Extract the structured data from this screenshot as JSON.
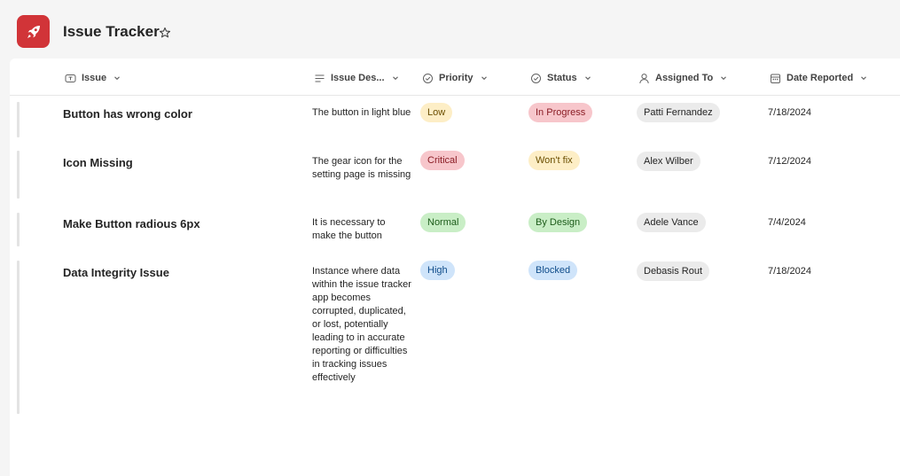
{
  "app": {
    "title": "Issue Tracker",
    "icon": "rocket-icon",
    "brand_color": "#d13438"
  },
  "columns": [
    {
      "label": "Issue",
      "icon": "text-field-icon"
    },
    {
      "label": "Issue Des...",
      "icon": "multiline-text-icon"
    },
    {
      "label": "Priority",
      "icon": "choice-check-icon"
    },
    {
      "label": "Status",
      "icon": "choice-check-icon"
    },
    {
      "label": "Assigned To",
      "icon": "person-icon"
    },
    {
      "label": "Date Reported",
      "icon": "calendar-icon"
    }
  ],
  "rows": [
    {
      "issue": "Button has wrong color",
      "description": "The button in light blue",
      "priority": "Low",
      "status": "In Progress",
      "assigned_to": "Patti Fernandez",
      "date_reported": "7/18/2024"
    },
    {
      "issue": "Icon Missing",
      "description": "The gear icon for the setting page is missing",
      "priority": "Critical",
      "status": "Won't fix",
      "assigned_to": "Alex Wilber",
      "date_reported": "7/12/2024"
    },
    {
      "issue": "Make Button radious 6px",
      "description": "It is necessary to make the button",
      "priority": "Normal",
      "status": "By Design",
      "assigned_to": "Adele Vance",
      "date_reported": "7/4/2024"
    },
    {
      "issue": "Data Integrity Issue",
      "description": "Instance where data within the issue tracker app becomes corrupted, duplicated, or lost, potentially leading to in accurate reporting or difficulties in tracking issues effectively",
      "priority": "High",
      "status": "Blocked",
      "assigned_to": "Debasis Rout",
      "date_reported": "7/18/2024"
    }
  ],
  "pill_colors": {
    "Low": {
      "bg": "#fdeec6",
      "fg": "#6b4e00"
    },
    "Critical": {
      "bg": "#f7c6cb",
      "fg": "#8a1c24"
    },
    "Normal": {
      "bg": "#c9eec6",
      "fg": "#1d5c1a"
    },
    "High": {
      "bg": "#cfe4fa",
      "fg": "#0f4c8a"
    },
    "In Progress": {
      "bg": "#f7c6cb",
      "fg": "#8a1c24"
    },
    "Won't fix": {
      "bg": "#fdeec6",
      "fg": "#6b4e00"
    },
    "By Design": {
      "bg": "#c9eec6",
      "fg": "#1d5c1a"
    },
    "Blocked": {
      "bg": "#cfe4fa",
      "fg": "#0f4c8a"
    }
  }
}
